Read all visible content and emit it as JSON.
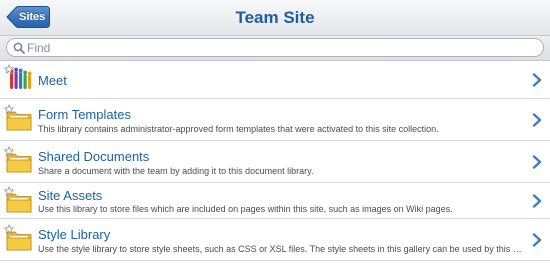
{
  "nav": {
    "back_label": "Sites",
    "title": "Team Site"
  },
  "search": {
    "placeholder": "Find",
    "value": ""
  },
  "items": [
    {
      "title": "Meet",
      "description": "",
      "icon": "meet-icon"
    },
    {
      "title": "Form Templates",
      "description": "This library contains administrator-approved form templates that were activated to this site collection.",
      "icon": "folder-icon"
    },
    {
      "title": "Shared Documents",
      "description": "Share a document with the team by adding it to this document library.",
      "icon": "folder-icon"
    },
    {
      "title": "Site Assets",
      "description": "Use this library to store files which are included on pages within this site, such as images on Wiki pages.",
      "icon": "folder-icon"
    },
    {
      "title": "Style Library",
      "description": "Use the style library to store style sheets, such as CSS or XSL files. The style sheets in this gallery can be used by this site or ...",
      "icon": "folder-icon"
    }
  ],
  "colors": {
    "title_blue": "#1f5d9c",
    "link_blue": "#1a63a6",
    "back_button_blue": "#2f6fb6",
    "chevron_blue": "#3f7cc4"
  }
}
